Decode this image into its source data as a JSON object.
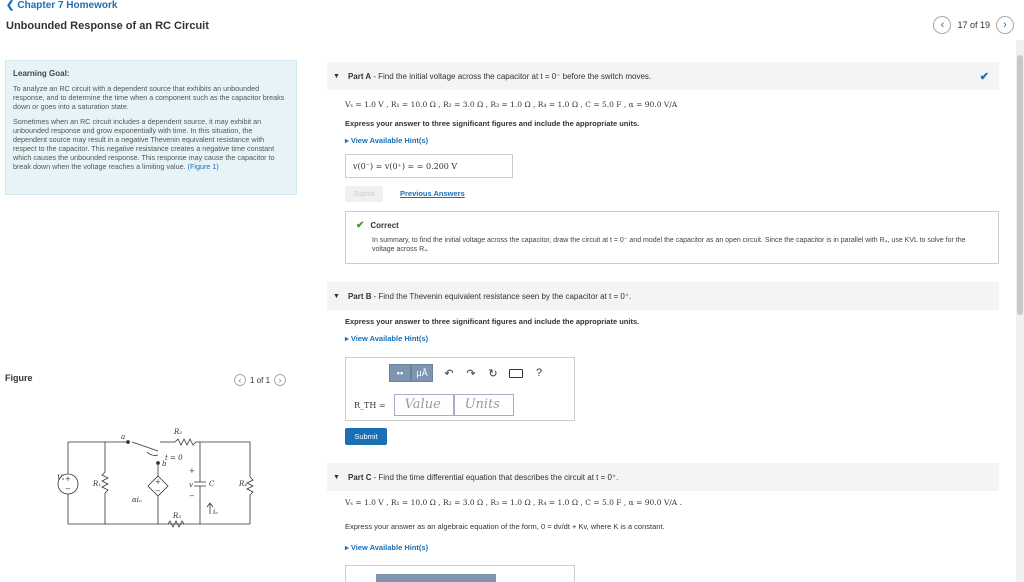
{
  "header": {
    "back_label": "Chapter 7 Homework",
    "title": "Unbounded Response of an RC Circuit",
    "pager_text": "17 of 19"
  },
  "goal": {
    "title": "Learning Goal:",
    "para1": "To analyze an RC circuit with a dependent source that exhibits an unbounded response, and to determine the time when a component such as the capacitor breaks down or goes into a saturation state.",
    "para2": "Sometimes when an RC circuit includes a dependent source, it may exhibit an unbounded response and grow exponentially with time. In this situation, the dependent source may result in a negative Thevenin equivalent resistance with respect to the capacitor. This negative resistance creates a negative time constant which causes the unbounded response. This response may cause the capacitor to break down when the voltage reaches a limiting value.",
    "figure_link": "(Figure 1)"
  },
  "figure": {
    "label": "Figure",
    "pager_text": "1 of 1"
  },
  "partA": {
    "label": "Part A",
    "question": " - Find the initial voltage across the capacitor at t = 0⁻ before the switch moves.",
    "given": "Vₛ = 1.0 V , R₁ = 10.0 Ω , R₂ = 3.0 Ω , R₃ = 1.0 Ω , R₄ = 1.0 Ω , C = 5.0 F , α = 90.0 V/A",
    "instruction": "Express your answer to three significant figures and include the appropriate units.",
    "hint": "▸ View Available Hint(s)",
    "answer": "v(0⁻) = v(0⁺) = = 0.200 V",
    "submit_label": "Submit",
    "previous_label": "Previous Answers",
    "correct_title": "Correct",
    "correct_body": "In summary, to find the initial voltage across the capacitor, draw the circuit at t = 0⁻ and model the capacitor as an open circuit. Since the capacitor is in parallel with R₄, use KVL to solve for the voltage across R₄."
  },
  "partB": {
    "label": "Part B",
    "question": " - Find the Thevenin equivalent resistance seen by the capacitor at t = 0⁺.",
    "instruction": "Express your answer to three significant figures and include the appropriate units.",
    "hint": "▸ View Available Hint(s)",
    "field_label": "R_TH =",
    "value_placeholder": "Value",
    "units_placeholder": "Units",
    "mu_label": "μÅ",
    "help_label": "?",
    "submit_label": "Submit"
  },
  "partC": {
    "label": "Part C",
    "question": " - Find the time differential equation that describes the circuit at t = 0⁺.",
    "given": "Vₛ = 1.0 V , R₁ = 10.0 Ω , R₂ = 3.0 Ω , R₃ = 1.0 Ω , R₄ = 1.0 Ω , C = 5.0 F , α = 90.0 V/A .",
    "instruction": "Express your answer as an algebraic equation of the form, 0 = dv/dt + Kv, where K is a constant.",
    "hint": "▸ View Available Hint(s)"
  },
  "circuit": {
    "vs": "Vₛ",
    "r1": "R₁",
    "r2": "R₂",
    "r3": "R₃",
    "r4": "R₄",
    "a": "a",
    "b": "b",
    "t0": "t = 0",
    "v": "v",
    "c": "C",
    "ai": "αiₒ",
    "io": "iₒ",
    "plus": "+",
    "minus": "−"
  }
}
